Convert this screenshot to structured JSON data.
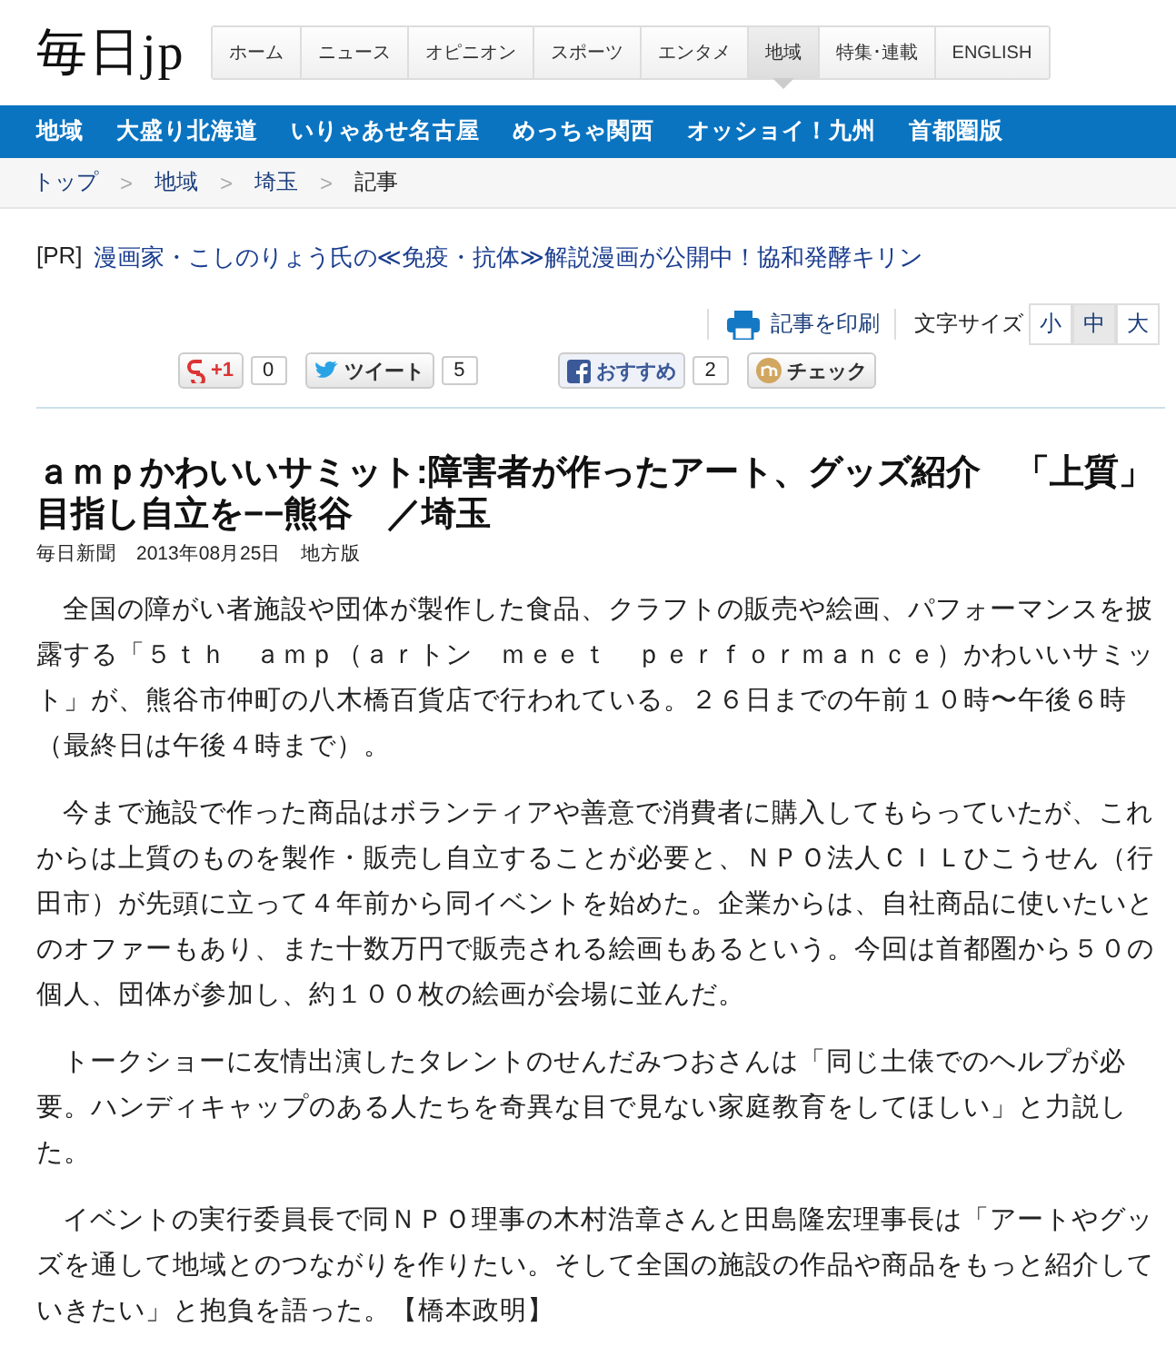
{
  "logo": "毎日jp",
  "nav_tabs": [
    {
      "label": "ホーム",
      "selected": false
    },
    {
      "label": "ニュース",
      "selected": false
    },
    {
      "label": "オピニオン",
      "selected": false
    },
    {
      "label": "スポーツ",
      "selected": false
    },
    {
      "label": "エンタメ",
      "selected": false
    },
    {
      "label": "地域",
      "selected": true
    },
    {
      "label": "特集･連載",
      "selected": false
    },
    {
      "label": "ENGLISH",
      "selected": false
    }
  ],
  "region_nav": [
    "地域",
    "大盛り北海道",
    "いりゃあせ名古屋",
    "めっちゃ関西",
    "オッショイ！九州",
    "首都圏版"
  ],
  "breadcrumb": [
    {
      "label": "トップ",
      "kind": "link"
    },
    {
      "label": "地域",
      "kind": "link"
    },
    {
      "label": "埼玉",
      "kind": "link"
    },
    {
      "label": "記事",
      "kind": "current"
    }
  ],
  "breadcrumb_separator": ">",
  "ad": {
    "tag": "[PR]",
    "text": "漫画家・こしのりょう氏の≪免疫・抗体≫解説漫画が公開中！協和発酵キリン"
  },
  "tools": {
    "print": "記事を印刷",
    "font_size_label": "文字サイズ",
    "sizes": [
      {
        "label": "小",
        "selected": false
      },
      {
        "label": "中",
        "selected": true
      },
      {
        "label": "大",
        "selected": false
      }
    ]
  },
  "social": [
    {
      "kind": "gplus",
      "label": "+1",
      "count": "0"
    },
    {
      "kind": "twitter",
      "label": "ツイート",
      "count": "5"
    },
    {
      "kind": "facebook",
      "label": "おすすめ",
      "count": "2"
    },
    {
      "kind": "mixi",
      "label": "チェック"
    }
  ],
  "article": {
    "title": "ａｍｐかわいいサミット:障害者が作ったアート、グッズ紹介　「上質」目指し自立を−−熊谷　／埼玉",
    "byline": "毎日新聞　2013年08月25日　地方版",
    "paragraphs": [
      "全国の障がい者施設や団体が製作した食品、クラフトの販売や絵画、パフォーマンスを披露する「５ｔｈ　ａｍｐ（ａｒトン　ｍｅｅｔ　ｐｅｒｆｏｒｍａｎｃｅ）かわいいサミット」が、熊谷市仲町の八木橋百貨店で行われている。２６日までの午前１０時〜午後６時（最終日は午後４時まで）。",
      "今まで施設で作った商品はボランティアや善意で消費者に購入してもらっていたが、これからは上質のものを製作・販売し自立することが必要と、ＮＰＯ法人ＣＩＬひこうせん（行田市）が先頭に立って４年前から同イベントを始めた。企業からは、自社商品に使いたいとのオファーもあり、また十数万円で販売される絵画もあるという。今回は首都圏から５０の個人、団体が参加し、約１００枚の絵画が会場に並んだ。",
      "トークショーに友情出演したタレントのせんだみつおさんは「同じ土俵でのヘルプが必要。ハンディキャップのある人たちを奇異な目で見ない家庭教育をしてほしい」と力説した。",
      "イベントの実行委員長で同ＮＰＯ理事の木村浩章さんと田島隆宏理事長は「アートやグッズを通して地域とのつながりを作りたい。そして全国の施設の作品や商品をもっと紹介していきたい」と抱負を語った。【橋本政明】"
    ]
  }
}
